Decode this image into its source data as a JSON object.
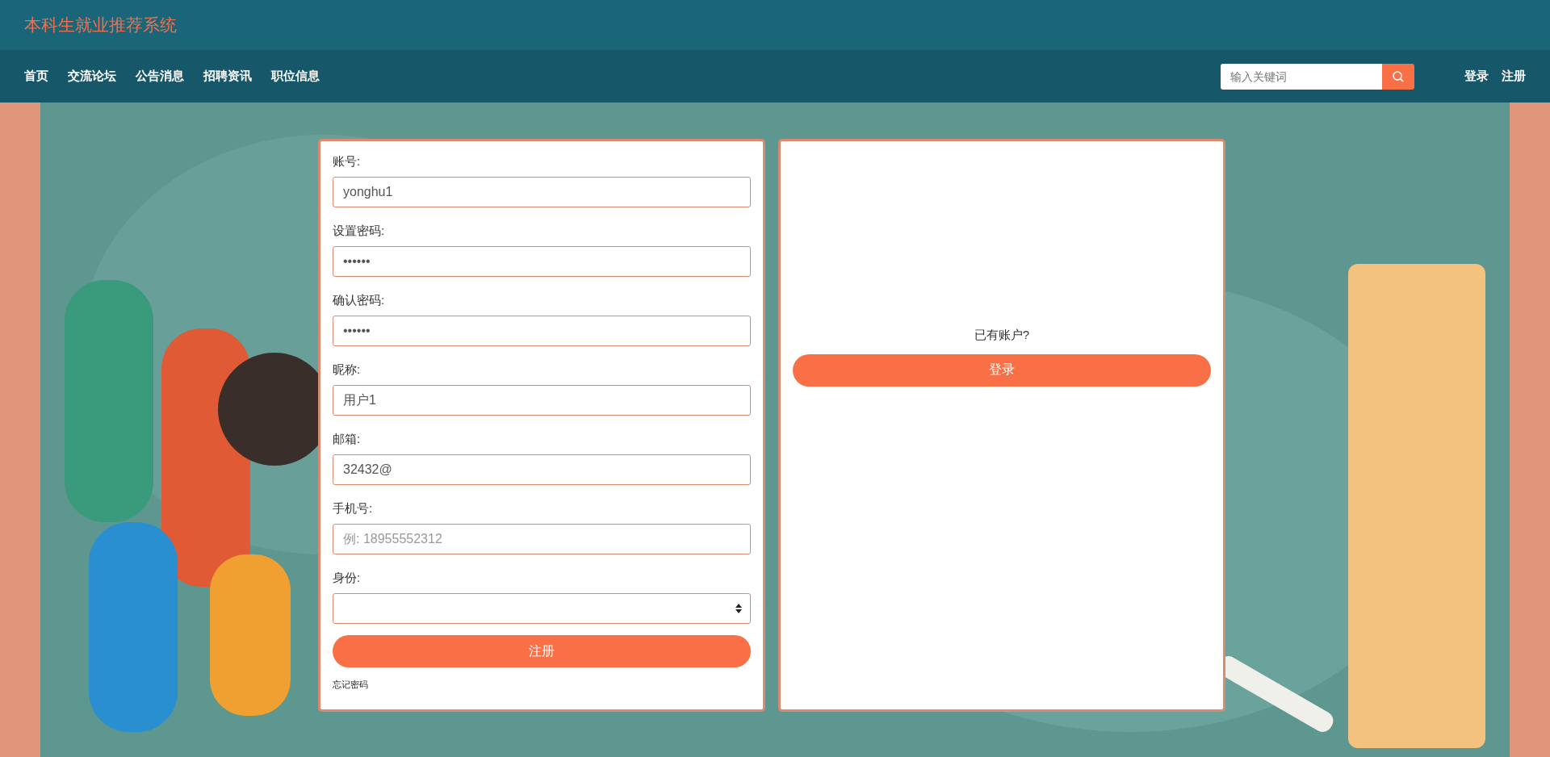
{
  "header": {
    "title": "本科生就业推荐系统"
  },
  "nav": {
    "items": [
      {
        "label": "首页"
      },
      {
        "label": "交流论坛"
      },
      {
        "label": "公告消息"
      },
      {
        "label": "招聘资讯"
      },
      {
        "label": "职位信息"
      }
    ],
    "search": {
      "placeholder": "输入关键词"
    },
    "links": [
      {
        "label": "登录"
      },
      {
        "label": "注册"
      }
    ]
  },
  "form": {
    "fields": [
      {
        "kind": "text",
        "label": "账号:",
        "value": "yonghu1"
      },
      {
        "kind": "text",
        "label": "设置密码:",
        "value": "••••••"
      },
      {
        "kind": "text",
        "label": "确认密码:",
        "value": "••••••"
      },
      {
        "kind": "text",
        "label": "昵称:",
        "value": "用户1"
      },
      {
        "kind": "text",
        "label": "邮箱:",
        "value": "32432@"
      },
      {
        "kind": "text",
        "label": "手机号:",
        "placeholder": "例: 18955552312"
      },
      {
        "kind": "select",
        "label": "身份:"
      }
    ],
    "submit": "注册",
    "forgot": "忘记密码"
  },
  "side": {
    "prompt": "已有账户?",
    "button": "登录"
  }
}
